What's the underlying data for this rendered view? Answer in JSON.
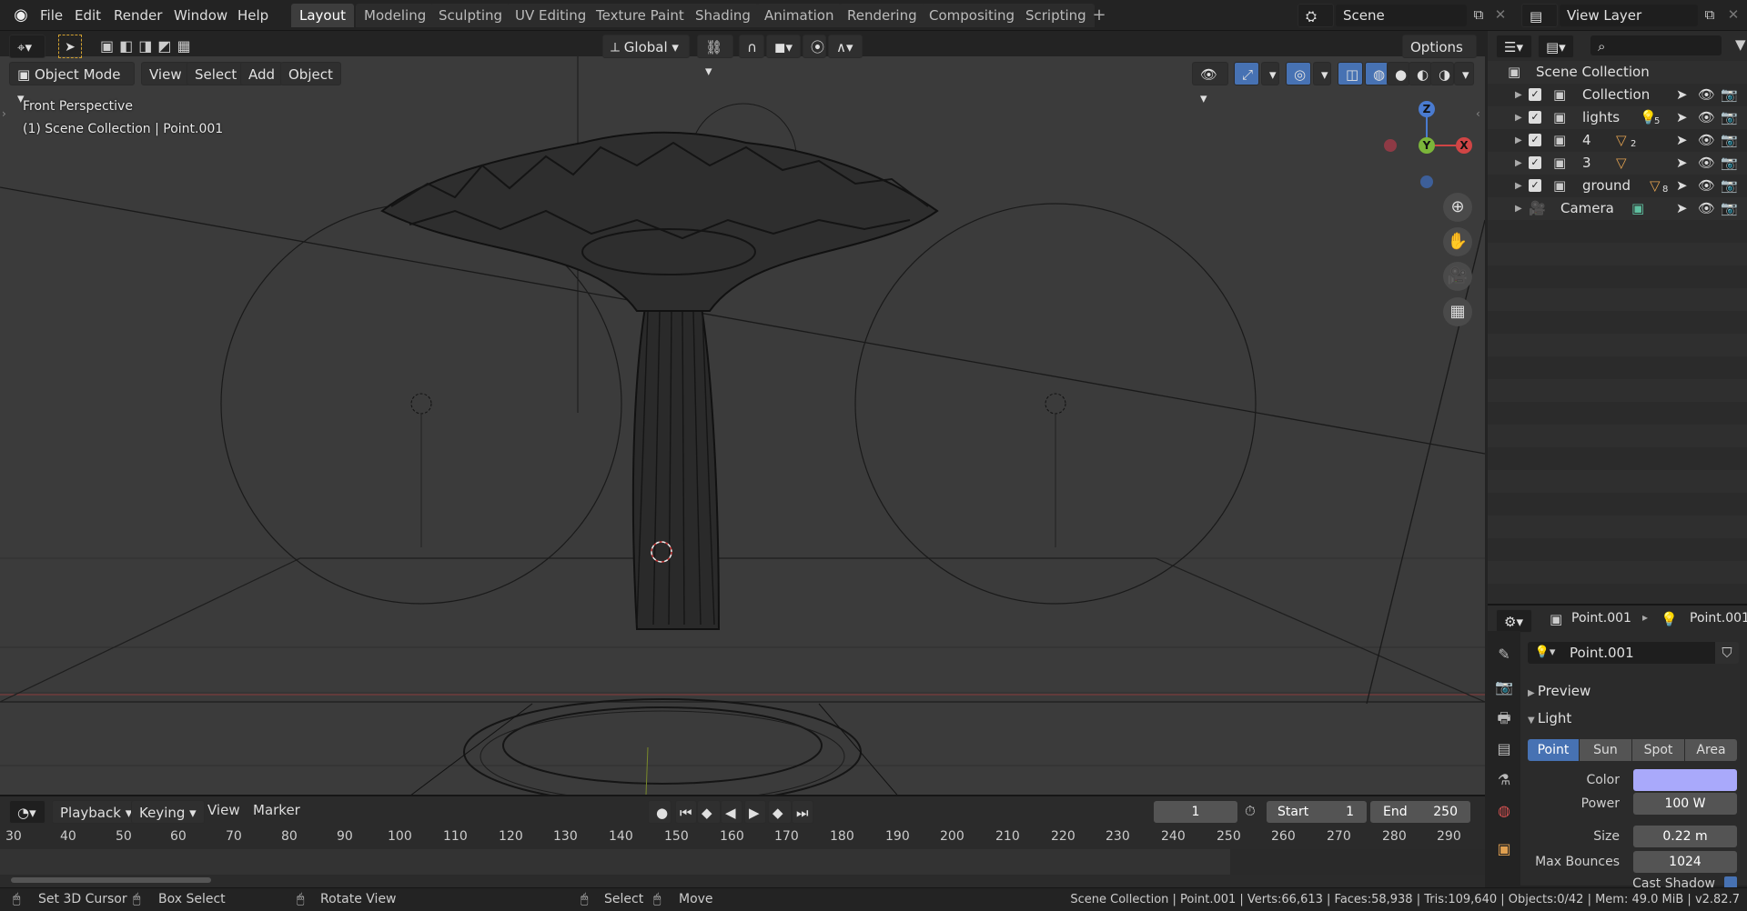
{
  "menu": [
    "File",
    "Edit",
    "Render",
    "Window",
    "Help"
  ],
  "workspaces": [
    "Layout",
    "Modeling",
    "Sculpting",
    "UV Editing",
    "Texture Paint",
    "Shading",
    "Animation",
    "Rendering",
    "Compositing",
    "Scripting"
  ],
  "active_workspace": "Layout",
  "scene_label": "Scene",
  "view_layer_label": "View Layer",
  "toolbar": {
    "orientation": "Global",
    "options": "Options"
  },
  "viewport_header": {
    "mode": "Object Mode",
    "menus": [
      "View",
      "Select",
      "Add",
      "Object"
    ]
  },
  "viewport_overlay": {
    "perspective": "Front Perspective",
    "context": "(1) Scene Collection | Point.001"
  },
  "gizmo": {
    "z": "Z",
    "y": "Y",
    "x": "X"
  },
  "outliner": {
    "root": "Scene Collection",
    "items": [
      {
        "name": "Collection"
      },
      {
        "name": "lights",
        "badge": "5"
      },
      {
        "name": "4",
        "badge": "2"
      },
      {
        "name": "3"
      },
      {
        "name": "ground",
        "badge": "8"
      },
      {
        "name": "Camera"
      }
    ]
  },
  "properties": {
    "breadcrumb_obj": "Point.001",
    "breadcrumb_data": "Point.001",
    "datablock": "Point.001",
    "panel_preview": "Preview",
    "panel_light": "Light",
    "light_types": [
      "Point",
      "Sun",
      "Spot",
      "Area"
    ],
    "active_type": "Point",
    "color_label": "Color",
    "color_value": "#a9a9fb",
    "power_label": "Power",
    "power_value": "100 W",
    "size_label": "Size",
    "size_value": "0.22 m",
    "bounces_label": "Max Bounces",
    "bounces_value": "1024",
    "shadow_label": "Cast Shadow"
  },
  "timeline": {
    "menus": [
      "Playback",
      "Keying",
      "View",
      "Marker"
    ],
    "current_frame": "1",
    "start_label": "Start",
    "start": "1",
    "end_label": "End",
    "end": "250",
    "ticks": [
      "30",
      "40",
      "50",
      "60",
      "70",
      "80",
      "90",
      "100",
      "110",
      "120",
      "130",
      "140",
      "150",
      "160",
      "170",
      "180",
      "190",
      "200",
      "210",
      "220",
      "230",
      "240",
      "250",
      "260",
      "270",
      "280",
      "290"
    ]
  },
  "status": {
    "hints": [
      "Set 3D Cursor",
      "Box Select",
      "Rotate View",
      "Select",
      "Move"
    ],
    "info": "Scene Collection | Point.001 | Verts:66,613 | Faces:58,938 | Tris:109,640 | Objects:0/42 | Mem: 49.0 MiB | v2.82.7"
  }
}
